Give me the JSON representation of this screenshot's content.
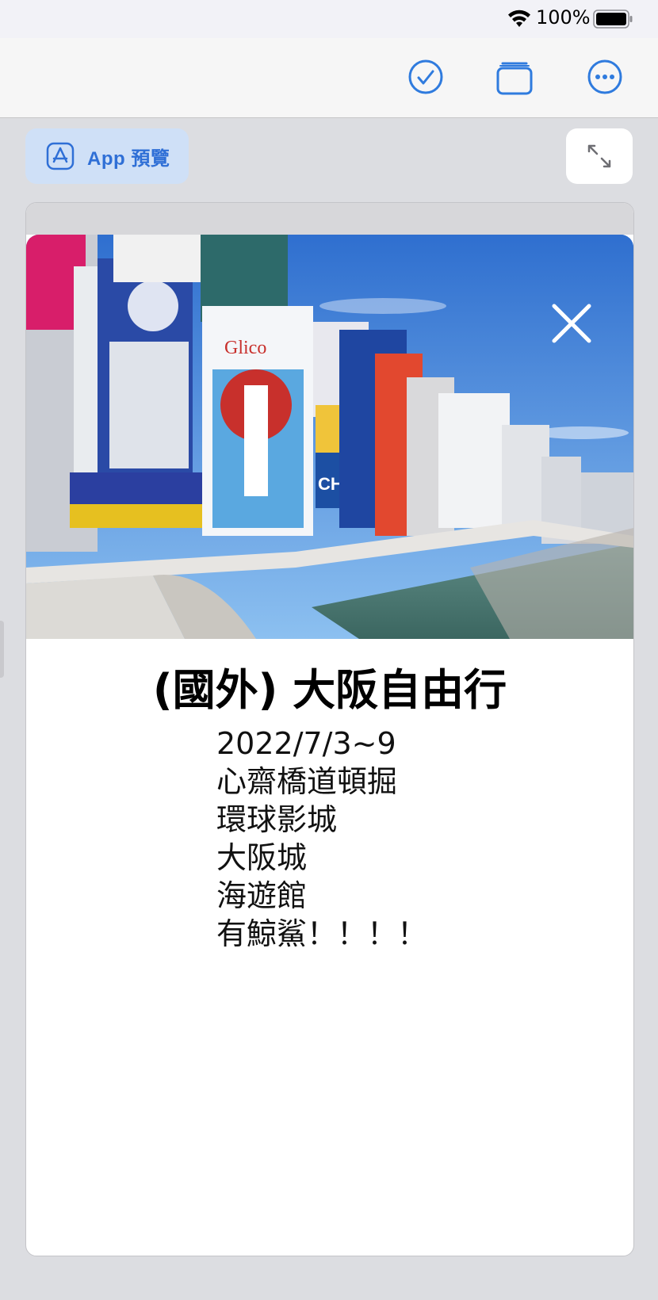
{
  "status_bar": {
    "battery_percent": "100%"
  },
  "toolbar": {
    "icons": [
      "checkmark-circle-icon",
      "stack-icon",
      "more-icon"
    ],
    "accent": "#2f7bde"
  },
  "actions": {
    "app_preview_label": "App 預覽"
  },
  "note": {
    "title": "(國外) 大阪自由行",
    "lines": [
      "2022/7/3~9",
      "心齋橋道頓掘",
      "環球影城",
      "大阪城",
      "海遊館",
      "有鯨鯊！！！！"
    ]
  }
}
